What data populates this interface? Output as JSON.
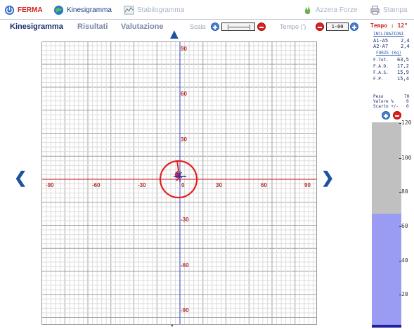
{
  "toolbar": {
    "ferma": "FERMA",
    "kinesigramma": "Kinesigramma",
    "stabilogramma": "Stabilogramma",
    "azzera": "Azzera Forze",
    "stampa": "Stampa"
  },
  "tabs": [
    "Kinesigramma",
    "Risultati",
    "Valutazione"
  ],
  "scala_label": "Scala",
  "tempo_label": "Tempo (')",
  "tempo_value": "1-00",
  "plot": {
    "x_ticks": [
      "-90",
      "-60",
      "-30",
      "0",
      "30",
      "60",
      "90"
    ],
    "y_ticks_top": [
      "90",
      "60",
      "30"
    ],
    "y_ticks_bottom": [
      "-30",
      "-60",
      "-90"
    ]
  },
  "panel": {
    "tempo": "Tempo : 12\"",
    "inclinazioni_title": "INCLINAZIONI",
    "a1a5_label": "A1-A5",
    "a1a5_value": "2,4",
    "a2a7_label": "A2-A7",
    "a2a7_value": "2,4",
    "forze_title": "FORZE (Kg)",
    "ftot_label": "F.Tot.",
    "ftot_value": "63,5",
    "fad_label": "F.A.D.",
    "fad_value": "17,2",
    "fas_label": "F.A.S.",
    "fas_value": "15,9",
    "fp_label": "F.P.",
    "fp_value": "15,4",
    "peso_label": "Peso",
    "peso_value": "70",
    "valore_label": "Valore %",
    "valore_value": "0",
    "scarto_label": "Scarto +/-",
    "scarto_value": "0",
    "bar_ticks": [
      "120",
      "100",
      "80",
      "60",
      "40",
      "20"
    ],
    "bar_level": 66
  },
  "colors": {
    "accent": "#1a3a8a",
    "red": "#e02020",
    "bar": "#9a9cf4"
  }
}
